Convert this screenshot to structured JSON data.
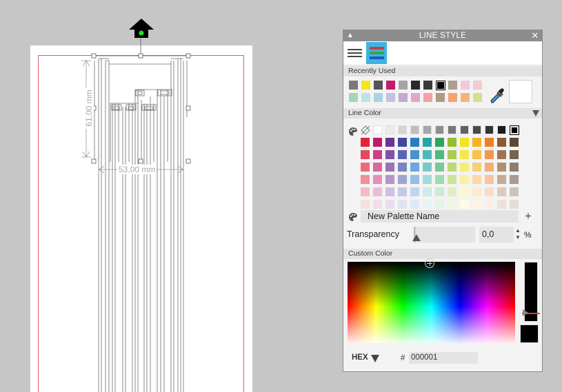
{
  "canvas": {
    "dim_width_label": "53,00 mm",
    "dim_height_label": "61,00 mm"
  },
  "panel": {
    "title": "LINE STYLE",
    "tabs": [
      {
        "name": "line-width-tab"
      },
      {
        "name": "line-color-tab",
        "active": true
      }
    ],
    "recently_used": {
      "label": "Recently Used",
      "row1": [
        "#7a7a7a",
        "#f5e51a",
        "#555555",
        "#c21a6e",
        "#a5a5a5",
        "#2a2a2a",
        "#3a3a3a",
        "#000000",
        "#ad9c90",
        "#f0cadb",
        "#f4c9cf"
      ],
      "row2": [
        "#a3d6b2",
        "#bde3e3",
        "#a9d2e6",
        "#c5c0e2",
        "#c3a8d3",
        "#e0a6cc",
        "#f4a0a8",
        "#b09a86",
        "#f3a46f",
        "#f5b377",
        "#d2e08f"
      ]
    },
    "line_color": {
      "label": "Line Color",
      "grays": [
        "#ffffff",
        "#ebebeb",
        "#d4d4d4",
        "#bdbdbd",
        "#a6a6a6",
        "#8f8f8f",
        "#787878",
        "#616161",
        "#4a4a4a",
        "#333333",
        "#1c1c1c",
        "#000000"
      ],
      "rows": [
        [
          "#e0233a",
          "#c0196b",
          "#6e3293",
          "#4147a3",
          "#2a7bc0",
          "#2aa3a6",
          "#2ea55c",
          "#98bd2f",
          "#f2e31c",
          "#f6b421",
          "#ee7f23",
          "#8a5a35",
          "#5e4632"
        ],
        [
          "#e6475b",
          "#cd3e84",
          "#8451a6",
          "#5a64b3",
          "#4a92cf",
          "#4fb8b9",
          "#4fb97a",
          "#abcb52",
          "#f4e84b",
          "#f7c14c",
          "#f2964d",
          "#9e7452",
          "#77614f"
        ],
        [
          "#ea6b7b",
          "#d8669f",
          "#9b72b7",
          "#7c83c2",
          "#6ea7d9",
          "#79c9c9",
          "#77c997",
          "#bdd776",
          "#f6ec76",
          "#f9ce77",
          "#f5ad76",
          "#b28f72",
          "#8f7d6d"
        ],
        [
          "#ef909c",
          "#e28fb9",
          "#b396c9",
          "#9ea4d2",
          "#93bde3",
          "#a3dada",
          "#9fdab5",
          "#cfe29b",
          "#f8f1a1",
          "#fbdba1",
          "#f8c4a0",
          "#c5ab95",
          "#a99b8e"
        ],
        [
          "#f5bcc4",
          "#ecbbd5",
          "#cfbfe0",
          "#c5c8e4",
          "#bdd6ee",
          "#cdebeb",
          "#c9ebd5",
          "#e2edc3",
          "#fbf7cc",
          "#fdebcc",
          "#fbdcca",
          "#dbcabd",
          "#cbc2b9"
        ],
        [
          "#f9dde1",
          "#f4dde9",
          "#e6deef",
          "#e1e3f1",
          "#dde9f6",
          "#e5f4f4",
          "#e3f4e9",
          "#f0f5e0",
          "#fdfbe5",
          "#fef4e5",
          "#fdede4",
          "#ebe2db",
          "#e3ddd8"
        ]
      ]
    },
    "palette_name": "New Palette Name",
    "transparency": {
      "label": "Transparency",
      "value": "0,0",
      "unit": "%"
    },
    "custom_color": {
      "label": "Custom Color"
    },
    "hex": {
      "label": "HEX",
      "hash": "#",
      "value": "000001"
    }
  }
}
